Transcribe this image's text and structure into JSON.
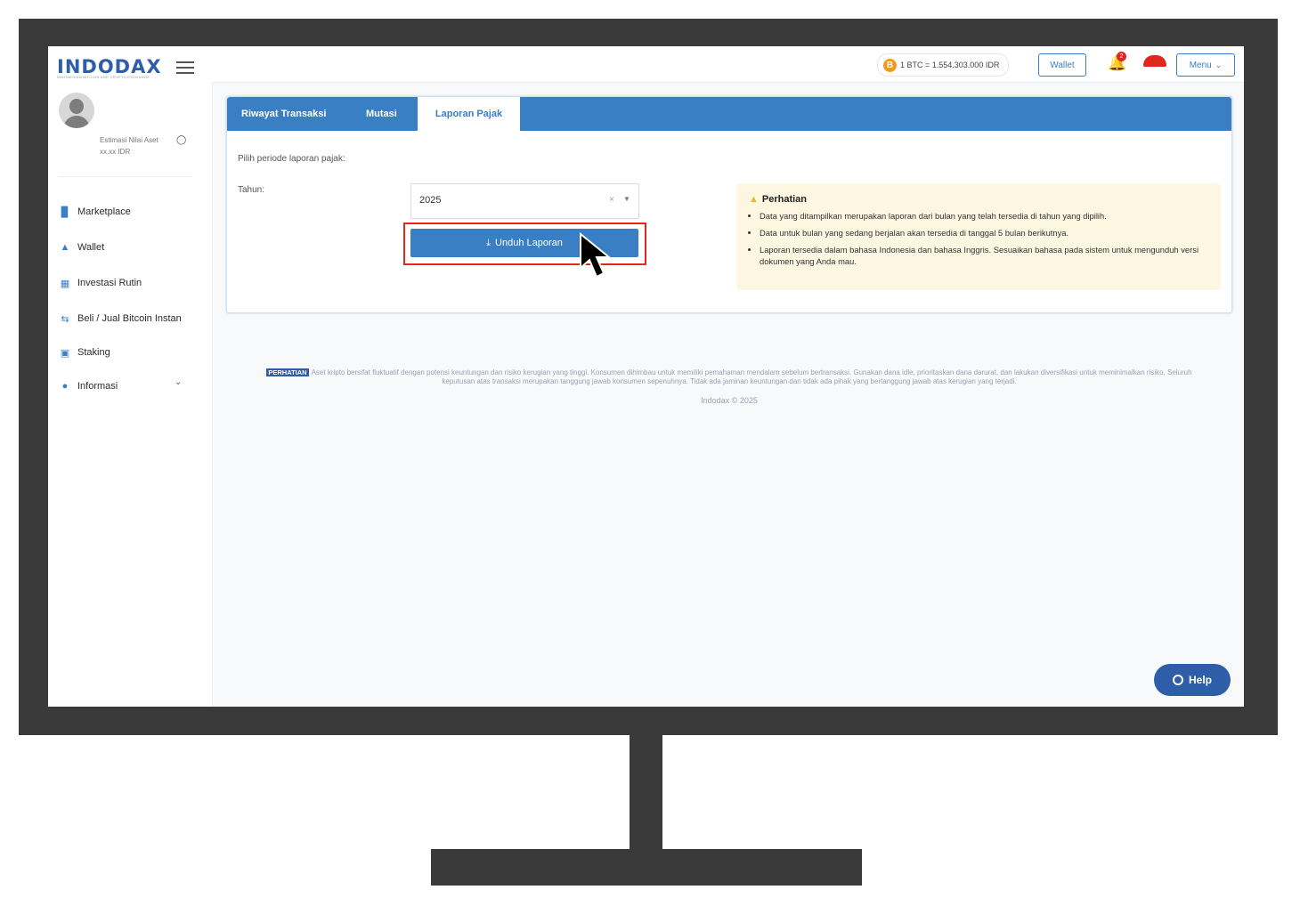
{
  "brand": {
    "logo": "INDODAX",
    "tagline": "INDONESIAN BITCOIN AND CRYPTO EXCHANGE",
    "accent": "#3a7fc4"
  },
  "sidebar": {
    "asset_label": "Estimasi Nilai Aset",
    "asset_value": "xx.xx IDR",
    "items": [
      {
        "label": "Marketplace",
        "icon": "chart-bar-icon"
      },
      {
        "label": "Wallet",
        "icon": "wallet-icon"
      },
      {
        "label": "Investasi Rutin",
        "icon": "calendar-icon"
      },
      {
        "label": "Beli / Jual Bitcoin Instan",
        "icon": "exchange-arrows-icon"
      },
      {
        "label": "Staking",
        "icon": "staking-icon"
      },
      {
        "label": "Informasi",
        "icon": "info-icon"
      }
    ]
  },
  "topbar": {
    "price": "1 BTC = 1.554.303.000 IDR",
    "wallet_label": "Wallet",
    "notification_count": "2",
    "menu_label": "Menu"
  },
  "tabs": [
    {
      "label": "Riwayat Transaksi",
      "active": false
    },
    {
      "label": "Mutasi",
      "active": false
    },
    {
      "label": "Laporan Pajak",
      "active": true
    }
  ],
  "form": {
    "period_label": "Pilih periode laporan pajak:",
    "year_label": "Tahun:",
    "year_value": "2025",
    "download_label": "Unduh Laporan"
  },
  "notice": {
    "title": "Perhatian",
    "items": [
      "Data yang ditampilkan merupakan laporan dari bulan yang telah tersedia di tahun yang dipilih.",
      "Data untuk bulan yang sedang berjalan akan tersedia di tanggal 5 bulan berikutnya.",
      "Laporan tersedia dalam bahasa Indonesia dan bahasa Inggris. Sesuaikan bahasa pada sistem untuk mengunduh versi dokumen yang Anda mau."
    ]
  },
  "footer": {
    "badge": "PERHATIAN",
    "disclaimer": "Aset kripto bersifat fluktuatif dengan potensi keuntungan dan risiko kerugian yang tinggi. Konsumen dihimbau untuk memiliki pemahaman mendalam sebelum bertransaksi. Gunakan dana idle, prioritaskan dana darurat, dan lakukan diversifikasi untuk meminimalkan risiko. Seluruh keputusan atas transaksi merupakan tanggung jawab konsumen sepenuhnya. Tidak ada jaminan keuntungan dan tidak ada pihak yang bertanggung jawab atas kerugian yang terjadi.",
    "copyright": "Indodax © 2025"
  },
  "help": {
    "label": "Help"
  }
}
